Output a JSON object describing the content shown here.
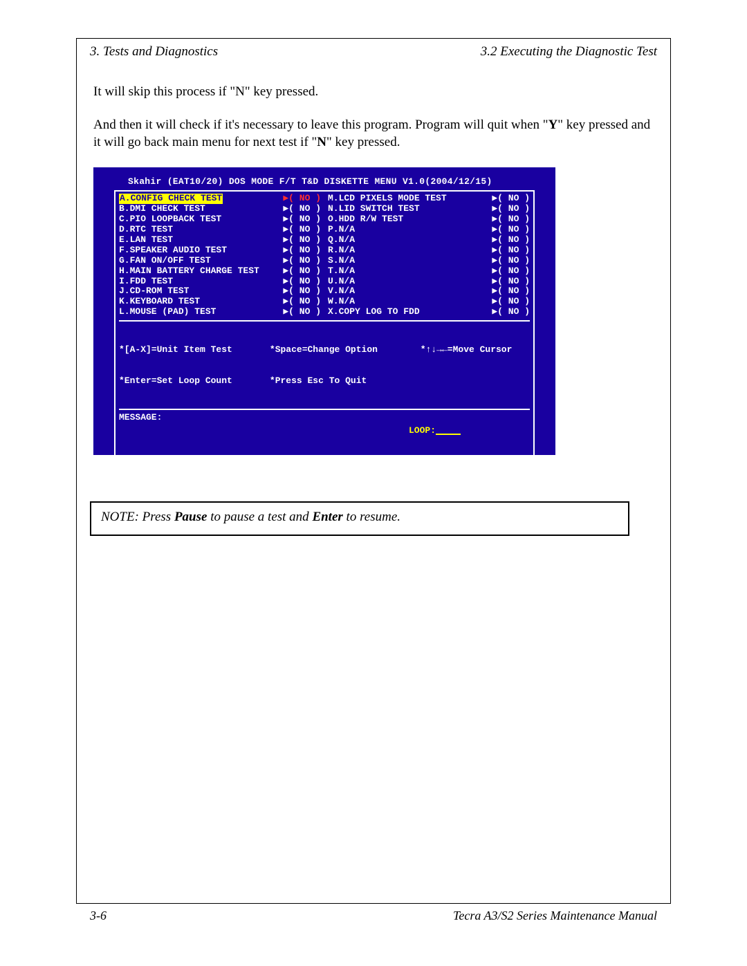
{
  "header": {
    "left": "3.  Tests and Diagnostics",
    "right": "3.2  Executing the Diagnostic Test"
  },
  "body": {
    "para1": "It will skip this process if \"N\" key pressed.",
    "para2_pre": "And then it will check if it's necessary to leave this program. Program will quit when \"",
    "para2_y": "Y",
    "para2_mid": "\" key pressed and it will go back main menu for next test if \"",
    "para2_n": "N",
    "para2_post": "\" key pressed."
  },
  "menu": {
    "title": "Skahir (EAT10/20) DOS MODE F/T T&D DISKETTE MENU V1.0(2004/12/15)",
    "left_items": [
      {
        "label": "A.CONFIG CHECK TEST",
        "val": "▶( NO )"
      },
      {
        "label": "B.DMI CHECK TEST",
        "val": "▶( NO )"
      },
      {
        "label": "C.PIO LOOPBACK TEST",
        "val": "▶( NO )"
      },
      {
        "label": "D.RTC TEST",
        "val": "▶( NO )"
      },
      {
        "label": "E.LAN TEST",
        "val": "▶( NO )"
      },
      {
        "label": "F.SPEAKER AUDIO TEST",
        "val": "▶( NO )"
      },
      {
        "label": "G.FAN ON/OFF TEST",
        "val": "▶( NO )"
      },
      {
        "label": "H.MAIN BATTERY CHARGE TEST",
        "val": "▶( NO )"
      },
      {
        "label": "I.FDD TEST",
        "val": "▶( NO )"
      },
      {
        "label": "J.CD-ROM TEST",
        "val": "▶( NO )"
      },
      {
        "label": "K.KEYBOARD TEST",
        "val": "▶( NO )"
      },
      {
        "label": "L.MOUSE (PAD) TEST",
        "val": "▶( NO )"
      }
    ],
    "right_items": [
      {
        "label": "M.LCD PIXELS MODE TEST",
        "val": "▶( NO )"
      },
      {
        "label": "N.LID SWITCH TEST",
        "val": "▶( NO )"
      },
      {
        "label": "O.HDD R/W TEST",
        "val": "▶( NO )"
      },
      {
        "label": "P.N/A",
        "val": "▶( NO )"
      },
      {
        "label": "Q.N/A",
        "val": "▶( NO )"
      },
      {
        "label": "R.N/A",
        "val": "▶( NO )"
      },
      {
        "label": "S.N/A",
        "val": "▶( NO )"
      },
      {
        "label": "T.N/A",
        "val": "▶( NO )"
      },
      {
        "label": "U.N/A",
        "val": "▶( NO )"
      },
      {
        "label": "V.N/A",
        "val": "▶( NO )"
      },
      {
        "label": "W.N/A",
        "val": "▶( NO )"
      },
      {
        "label": "X.COPY LOG TO FDD",
        "val": "▶( NO )"
      }
    ],
    "help": {
      "c1a": "*[A-X]=Unit Item Test",
      "c1b": "*Enter=Set Loop Count",
      "c2a": "*Space=Change Option",
      "c2b": "*Press Esc To Quit",
      "c3a": "*↑↓→←=Move Cursor"
    },
    "message_label": "MESSAGE:",
    "loop_label": "LOOP:"
  },
  "note": {
    "prefix": "NOTE:",
    "t1": "  Press ",
    "b1": "Pause",
    "t2": " to pause a test and ",
    "b2": "Enter",
    "t3": " to resume."
  },
  "footer": {
    "left": "3-6",
    "right": "Tecra A3/S2 Series Maintenance Manual"
  }
}
